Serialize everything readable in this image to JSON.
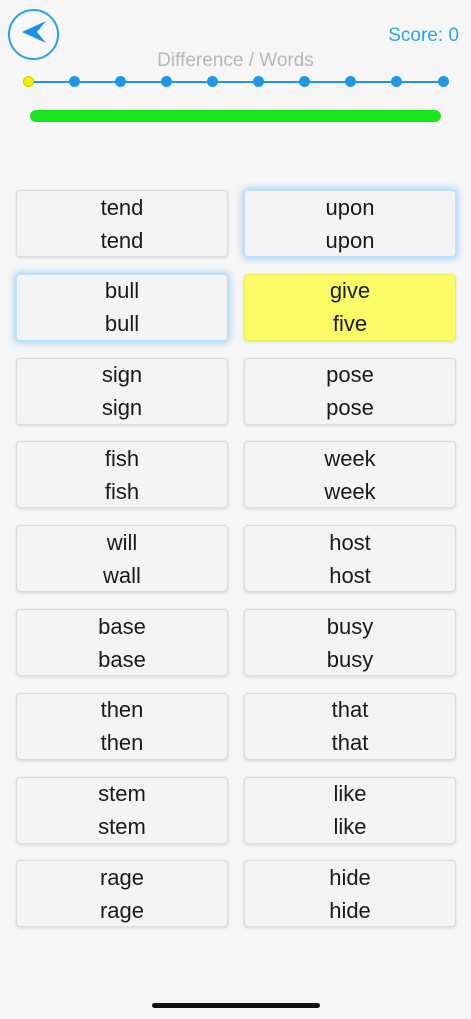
{
  "header": {
    "title": "Difference / Words",
    "score_text": "Score: 0"
  },
  "progress": {
    "total_steps": 10,
    "current_step": 1
  },
  "timer": {
    "fill_fraction": 1.0,
    "color": "#18e61c"
  },
  "colors": {
    "accent": "#2aa0ef",
    "highlight": "#fbfb66",
    "active_dot": "#f4f000"
  },
  "cards": [
    {
      "top": "tend",
      "bottom": "tend",
      "state": "normal"
    },
    {
      "top": "upon",
      "bottom": "upon",
      "state": "glow"
    },
    {
      "top": "bull",
      "bottom": "bull",
      "state": "glow"
    },
    {
      "top": "give",
      "bottom": "five",
      "state": "highlight"
    },
    {
      "top": "sign",
      "bottom": "sign",
      "state": "normal"
    },
    {
      "top": "pose",
      "bottom": "pose",
      "state": "normal"
    },
    {
      "top": "fish",
      "bottom": "fish",
      "state": "normal"
    },
    {
      "top": "week",
      "bottom": "week",
      "state": "normal"
    },
    {
      "top": "will",
      "bottom": "wall",
      "state": "normal"
    },
    {
      "top": "host",
      "bottom": "host",
      "state": "normal"
    },
    {
      "top": "base",
      "bottom": "base",
      "state": "normal"
    },
    {
      "top": "busy",
      "bottom": "busy",
      "state": "normal"
    },
    {
      "top": "then",
      "bottom": "then",
      "state": "normal"
    },
    {
      "top": "that",
      "bottom": "that",
      "state": "normal"
    },
    {
      "top": "stem",
      "bottom": "stem",
      "state": "normal"
    },
    {
      "top": "like",
      "bottom": "like",
      "state": "normal"
    },
    {
      "top": "rage",
      "bottom": "rage",
      "state": "normal"
    },
    {
      "top": "hide",
      "bottom": "hide",
      "state": "normal"
    }
  ]
}
